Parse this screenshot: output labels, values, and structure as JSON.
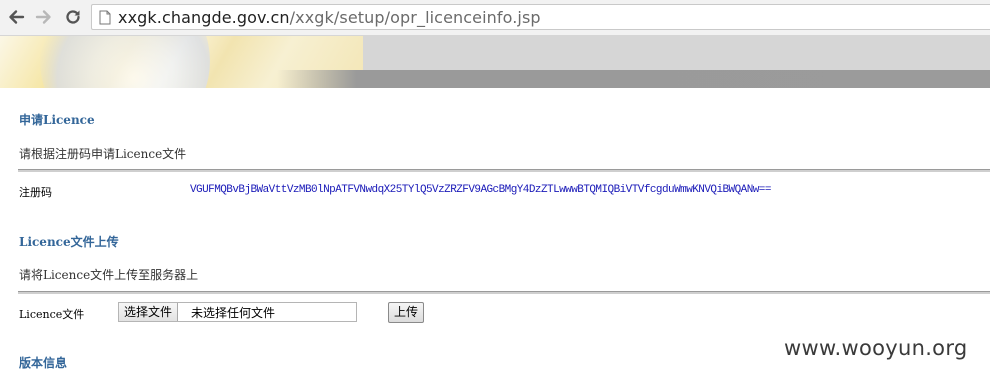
{
  "browser": {
    "url_host": "xxgk.changde.gov.cn",
    "url_path": "/xxgk/setup/opr_licenceinfo.jsp"
  },
  "apply_section": {
    "title": "申请Licence",
    "description": "请根据注册码申请Licence文件",
    "reg_code_label": "注册码",
    "reg_code_value": "VGUFMQBvBjBWaVttVzMB0lNpATFVNwdqX25TYlQ5VzZRZFV9AGcBMgY4DzZTLwwwBTQMIQBiVTVfcgduWmwKNVQiBWQANw=="
  },
  "upload_section": {
    "title": "Licence文件上传",
    "description": "请将Licence文件上传至服务器上",
    "file_label": "Licence文件",
    "choose_file_button": "选择文件",
    "file_status": "未选择任何文件",
    "upload_button": "上传"
  },
  "version_section": {
    "title": "版本信息"
  },
  "watermark": "www.wooyun.org",
  "colors": {
    "section_title": "#336699",
    "reg_code": "#1a1ab8"
  }
}
